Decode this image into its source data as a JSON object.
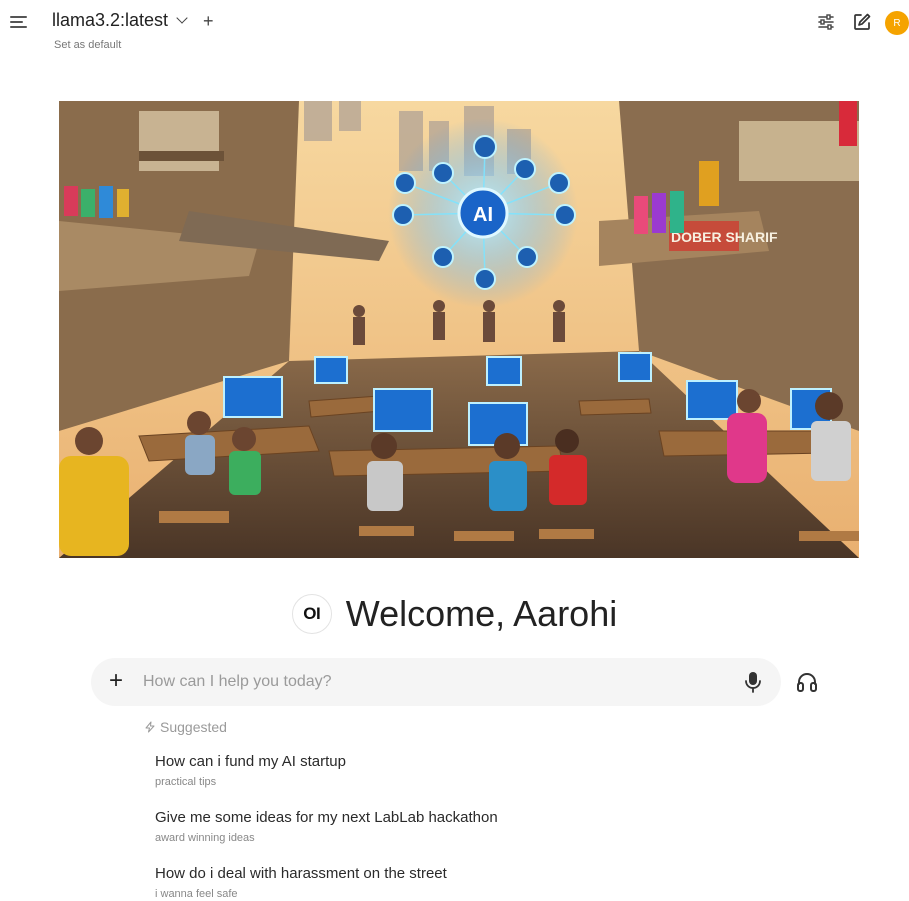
{
  "header": {
    "model_name": "llama3.2:latest",
    "set_default_label": "Set as default",
    "add_model_label": "+",
    "user_initial": "R",
    "colors": {
      "avatar": "#f5a300"
    }
  },
  "banner": {
    "sign_text": "DOBER SHARIF",
    "ai_badge": "AI"
  },
  "welcome": {
    "logo_text": "OI",
    "greeting": "Welcome, Aarohi"
  },
  "chat": {
    "add_label": "+",
    "placeholder": "How can I help you today?"
  },
  "suggested": {
    "heading": "Suggested",
    "items": [
      {
        "title": "How can i fund my AI startup",
        "subtitle": "practical tips"
      },
      {
        "title": "Give me some ideas for my next LabLab hackathon",
        "subtitle": "award winning ideas"
      },
      {
        "title": "How do i deal with harassment on the street",
        "subtitle": "i wanna feel safe"
      }
    ]
  }
}
